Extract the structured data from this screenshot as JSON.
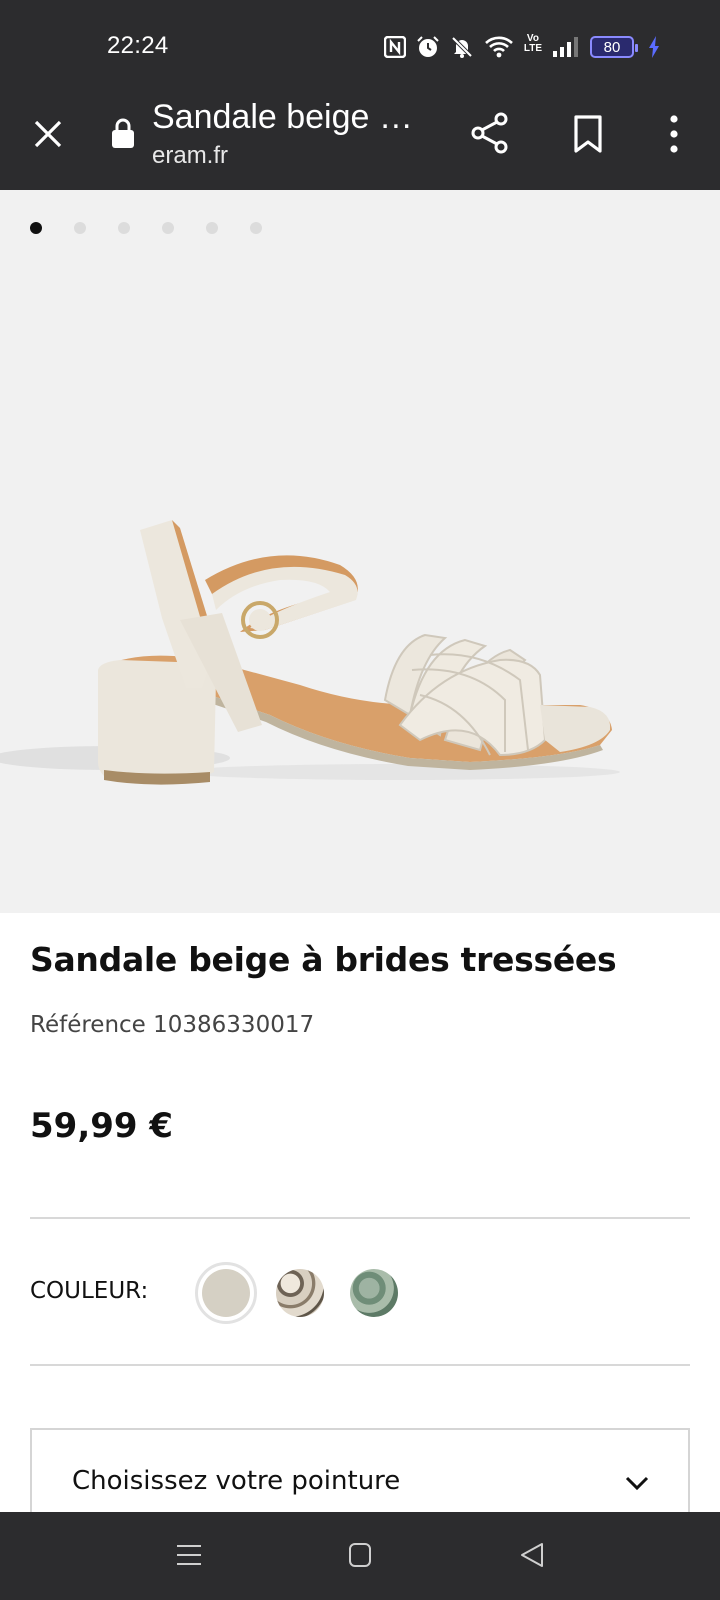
{
  "status_bar": {
    "time": "22:24",
    "battery": "80",
    "icons": [
      "nfc-icon",
      "alarm-icon",
      "mute-icon",
      "wifi-icon",
      "volte-icon",
      "signal-icon",
      "battery-icon",
      "charging-icon"
    ],
    "volte_top": "Vo",
    "volte_bottom": "LTE"
  },
  "toolbar": {
    "title": "Sandale beige …",
    "url": "eram.fr"
  },
  "gallery": {
    "dot_count": 6,
    "active_index": 0
  },
  "product": {
    "title": "Sandale beige à brides tressées",
    "reference": "Référence 10386330017",
    "price": "59,99 €"
  },
  "color": {
    "label": "COULEUR:",
    "swatches": [
      {
        "name": "beige",
        "hex": "#d5d0c4",
        "selected": true
      },
      {
        "name": "python",
        "hex": "#bdb2a2",
        "selected": false
      },
      {
        "name": "green",
        "hex": "#86a08d",
        "selected": false
      }
    ]
  },
  "size_select": {
    "placeholder": "Choisissez votre pointure"
  },
  "colors": {
    "bar_bg": "#2c2c2e",
    "image_bg": "#f1f1f1",
    "text": "#111111"
  }
}
